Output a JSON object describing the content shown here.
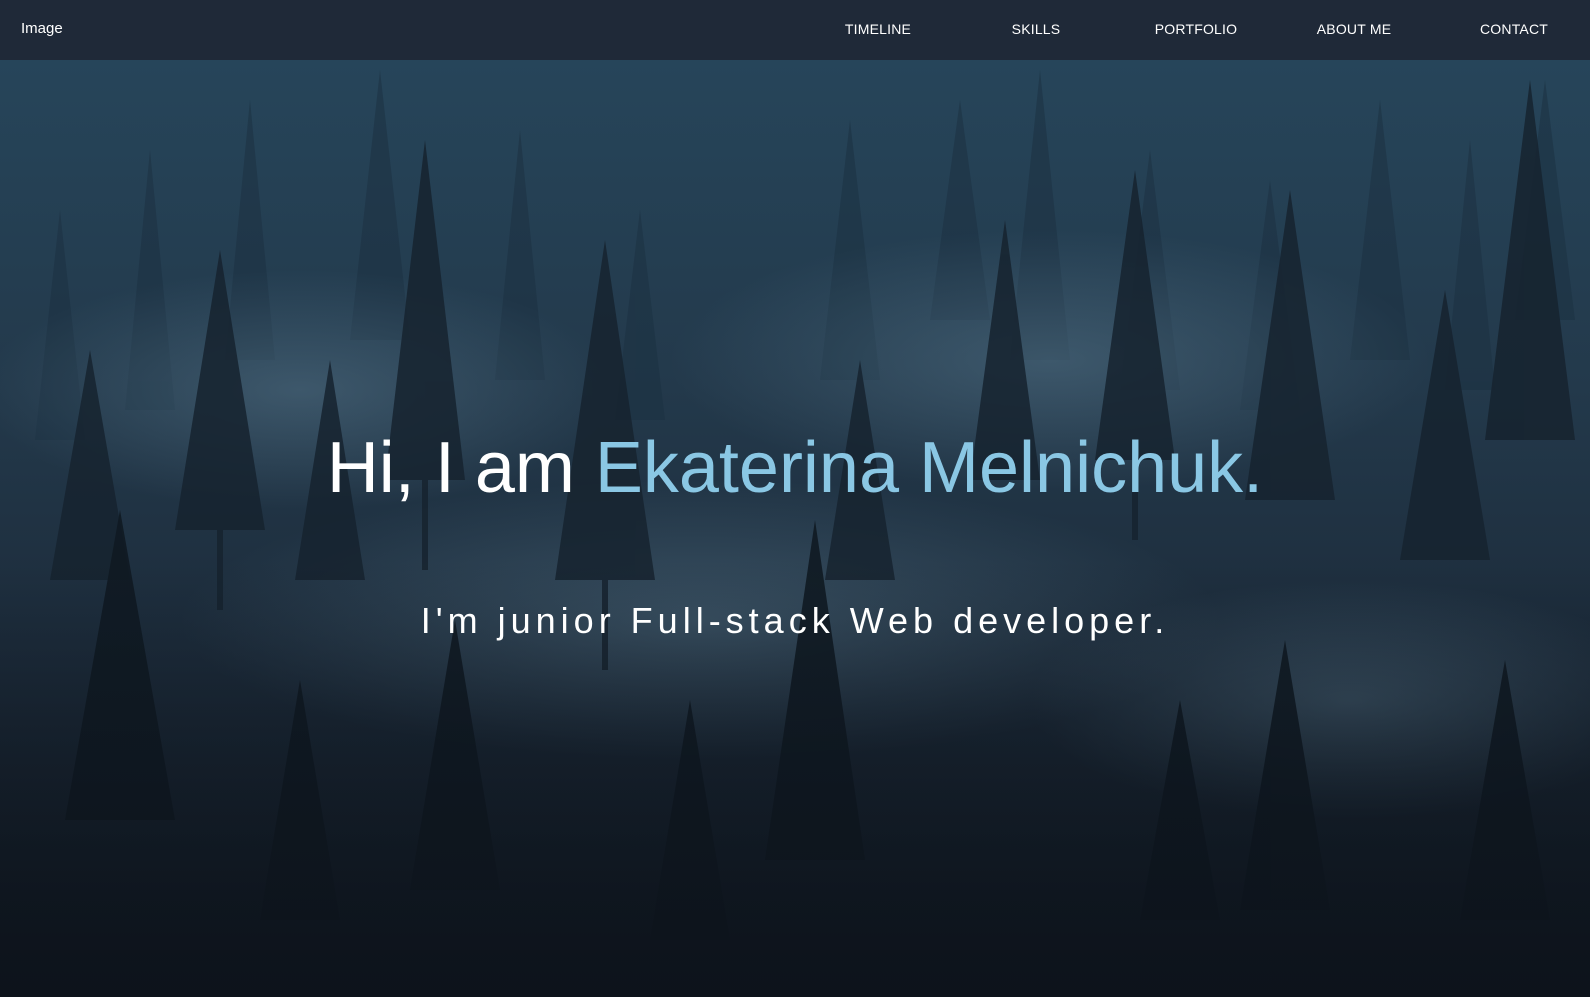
{
  "navbar": {
    "brand": "Image",
    "items": [
      "TIMELINE",
      "SKILLS",
      "PORTFOLIO",
      "ABOUT ME",
      "CONTACT"
    ]
  },
  "hero": {
    "greeting": "Hi, I am ",
    "name": "Ekaterina Melnichuk.",
    "tagline": "I'm junior Full-stack Web developer."
  },
  "colors": {
    "navbar_bg": "#1f2938",
    "name_accent": "#8ac7e4",
    "text": "#ffffff"
  }
}
